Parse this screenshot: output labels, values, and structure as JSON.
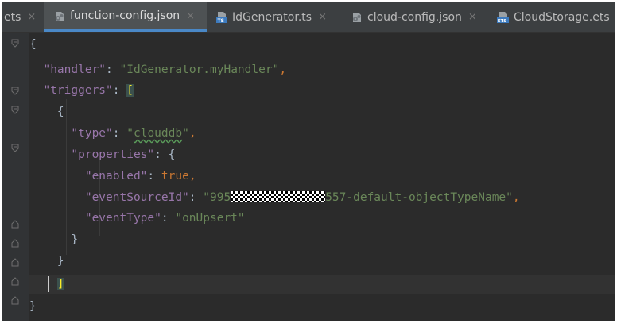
{
  "tabs": [
    {
      "label": "ets",
      "icon": "json-file-icon",
      "active": false,
      "close": "×"
    },
    {
      "label": "function-config.json",
      "icon": "json-file-icon",
      "active": true,
      "close": "×"
    },
    {
      "label": "IdGenerator.ts",
      "icon": "ts-file-icon",
      "active": false,
      "close": "×"
    },
    {
      "label": "cloud-config.json",
      "icon": "json-file-icon",
      "active": false,
      "close": "×"
    },
    {
      "label": "CloudStorage.ets",
      "icon": "ets-file-icon",
      "active": false,
      "close": ""
    }
  ],
  "code": {
    "l1": {
      "brace": "{"
    },
    "l2": {
      "key": "\"handler\"",
      "colon": ": ",
      "value": "\"IdGenerator.myHandler\"",
      "comma": ","
    },
    "l3": {
      "key": "\"triggers\"",
      "colon": ": ",
      "bracket": "["
    },
    "l4": {
      "brace": "{"
    },
    "l5": {
      "key": "\"type\"",
      "colon": ": ",
      "q1": "\"",
      "value": "clouddb",
      "q2": "\"",
      "comma": ","
    },
    "l6": {
      "key": "\"properties\"",
      "colon": ": ",
      "brace": "{"
    },
    "l7": {
      "key": "\"enabled\"",
      "colon": ": ",
      "value": "true",
      "comma": ","
    },
    "l8": {
      "key": "\"eventSourceId\"",
      "colon": ": ",
      "value_prefix": "\"995",
      "value_suffix": "557-default-objectTypeName\"",
      "comma": ","
    },
    "l9": {
      "key": "\"eventType\"",
      "colon": ": ",
      "value": "\"onUpsert\""
    },
    "l10": {
      "brace": "}"
    },
    "l11": {
      "brace": "}"
    },
    "l12": {
      "bracket": "]"
    },
    "l13": {
      "brace": "}"
    }
  },
  "colors": {
    "key": "#9876aa",
    "string": "#6a8759",
    "keyword": "#cc7832",
    "bracket_highlight": "#ffef28",
    "editor_bg": "#2b2b2b",
    "tab_accent": "#4a88c7"
  }
}
